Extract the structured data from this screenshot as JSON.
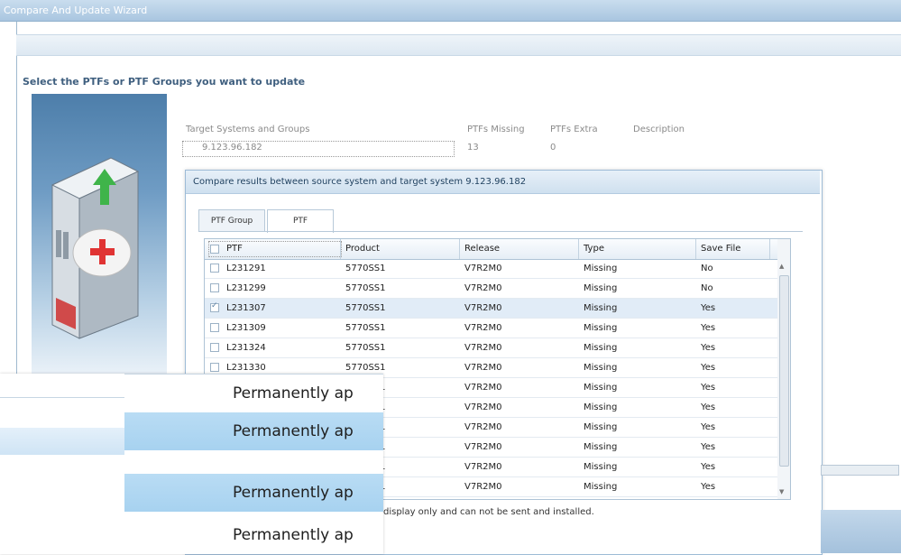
{
  "window": {
    "title": "Compare And Update Wizard"
  },
  "instruction": "Select the PTFs or PTF Groups you want to update",
  "targets": {
    "headers": [
      "Target Systems and Groups",
      "PTFs Missing",
      "PTFs Extra",
      "Description"
    ],
    "row": {
      "system": "9.123.96.182",
      "missing": "13",
      "extra": "0"
    }
  },
  "dialog": {
    "title": "Compare results between source system and target system 9.123.96.182",
    "tabs": [
      "PTF Group",
      "PTF"
    ],
    "columns": [
      "PTF",
      "Product",
      "Release",
      "Type",
      "Save File"
    ],
    "rows": [
      {
        "ptf": "L231291",
        "product": "5770SS1",
        "release": "V7R2M0",
        "type": "Missing",
        "save": "No",
        "checked": false
      },
      {
        "ptf": "L231299",
        "product": "5770SS1",
        "release": "V7R2M0",
        "type": "Missing",
        "save": "No",
        "checked": false
      },
      {
        "ptf": "L231307",
        "product": "5770SS1",
        "release": "V7R2M0",
        "type": "Missing",
        "save": "Yes",
        "checked": true
      },
      {
        "ptf": "L231309",
        "product": "5770SS1",
        "release": "V7R2M0",
        "type": "Missing",
        "save": "Yes",
        "checked": false
      },
      {
        "ptf": "L231324",
        "product": "5770SS1",
        "release": "V7R2M0",
        "type": "Missing",
        "save": "Yes",
        "checked": false
      },
      {
        "ptf": "L231330",
        "product": "5770SS1",
        "release": "V7R2M0",
        "type": "Missing",
        "save": "Yes",
        "checked": false
      },
      {
        "ptf": "",
        "product": "5770SS1",
        "release": "V7R2M0",
        "type": "Missing",
        "save": "Yes",
        "checked": false
      },
      {
        "ptf": "",
        "product": "5770SS1",
        "release": "V7R2M0",
        "type": "Missing",
        "save": "Yes",
        "checked": false
      },
      {
        "ptf": "",
        "product": "5770SS1",
        "release": "V7R2M0",
        "type": "Missing",
        "save": "Yes",
        "checked": false
      },
      {
        "ptf": "",
        "product": "5770SS1",
        "release": "V7R2M0",
        "type": "Missing",
        "save": "Yes",
        "checked": false
      },
      {
        "ptf": "",
        "product": "5770SS1",
        "release": "V7R2M0",
        "type": "Missing",
        "save": "Yes",
        "checked": false
      },
      {
        "ptf": "",
        "product": "5770SS1",
        "release": "V7R2M0",
        "type": "Missing",
        "save": "Yes",
        "checked": false
      }
    ],
    "footnote": "display only and can not be sent and installed."
  },
  "popup": {
    "items": [
      "Permanently ap",
      "Permanently ap",
      "Permanently ap",
      "Permanently ap"
    ]
  }
}
